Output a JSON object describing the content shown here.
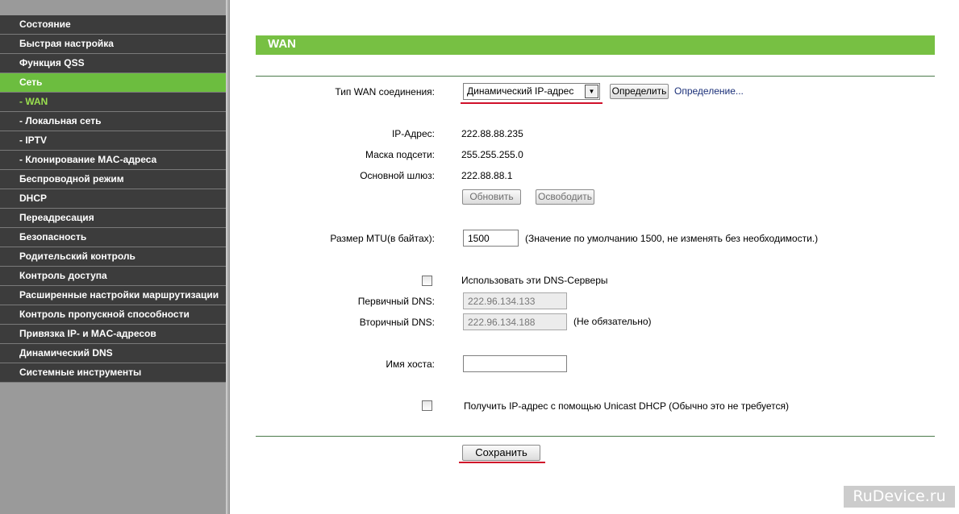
{
  "sidebar": {
    "items": [
      {
        "label": "Состояние"
      },
      {
        "label": "Быстрая настройка"
      },
      {
        "label": "Функция QSS"
      },
      {
        "label": "Сеть"
      },
      {
        "label": "- WAN"
      },
      {
        "label": "- Локальная сеть"
      },
      {
        "label": "- IPTV"
      },
      {
        "label": "- Клонирование MAC-адреса"
      },
      {
        "label": "Беспроводной режим"
      },
      {
        "label": "DHCP"
      },
      {
        "label": "Переадресация"
      },
      {
        "label": "Безопасность"
      },
      {
        "label": "Родительский контроль"
      },
      {
        "label": "Контроль доступа"
      },
      {
        "label": "Расширенные настройки маршрутизации"
      },
      {
        "label": "Контроль пропускной способности"
      },
      {
        "label": "Привязка IP- и MAC-адресов"
      },
      {
        "label": "Динамический DNS"
      },
      {
        "label": "Системные инструменты"
      }
    ],
    "accent": "#6cbd3f",
    "bg": "#3c3c3c"
  },
  "page": {
    "title": "WAN"
  },
  "form": {
    "wan_type_label": "Тип WAN соединения:",
    "wan_type_value": "Динамический IP-адрес",
    "detect_button": "Определить",
    "detect_link": "Определение...",
    "ip_label": "IP-Адрес:",
    "ip_value": "222.88.88.235",
    "mask_label": "Маска подсети:",
    "mask_value": "255.255.255.0",
    "gateway_label": "Основной шлюз:",
    "gateway_value": "222.88.88.1",
    "renew_button": "Обновить",
    "release_button": "Освободить",
    "mtu_label": "Размер MTU(в байтах):",
    "mtu_value": "1500",
    "mtu_hint": "(Значение по умолчанию 1500, не изменять без необходимости.)",
    "use_dns_label": "Использовать эти DNS-Серверы",
    "primary_dns_label": "Первичный DNS:",
    "primary_dns_value": "222.96.134.133",
    "secondary_dns_label": "Вторичный DNS:",
    "secondary_dns_value": "222.96.134.188",
    "secondary_dns_hint": "(Не обязательно)",
    "hostname_label": "Имя хоста:",
    "hostname_value": "",
    "unicast_label": "Получить IP-адрес с помощью Unicast DHCP (Обычно это не требуется)",
    "save_button": "Сохранить"
  },
  "watermark": "RuDevice.ru",
  "colors": {
    "title_bar": "#77c043",
    "highlight_underline": "#d0102a"
  }
}
